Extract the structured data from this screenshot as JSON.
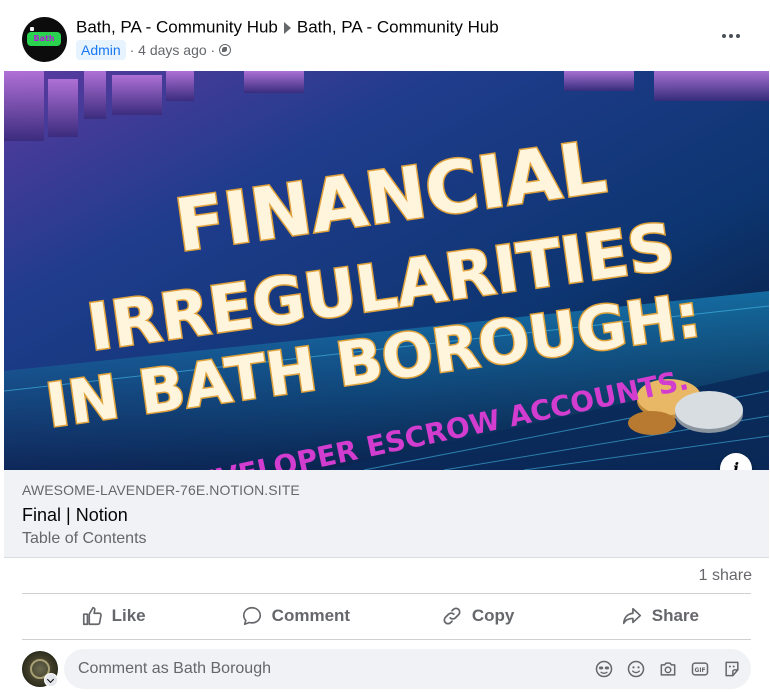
{
  "post": {
    "group_name": "Bath, PA - Community Hub",
    "group_name_repeat": "Bath, PA - Community Hub",
    "role_badge": "Admin",
    "timestamp": "4 days ago",
    "separator": "·",
    "avatar_badge_text": "Bath PA",
    "icons": {
      "more": "more-options-icon",
      "privacy": "globe-icon",
      "caret": "caret-right-icon"
    }
  },
  "hero": {
    "headline_line1": "FINANCIAL",
    "headline_line2": "IRREGULARITIES",
    "headline_line3": "IN BATH BOROUGH:",
    "subhead": "DEVELOPER ESCROW ACCOUNTS.",
    "info_label": "i"
  },
  "link_preview": {
    "domain": "AWESOME-LAVENDER-76E.NOTION.SITE",
    "title": "Final | Notion",
    "description": "Table of Contents"
  },
  "stats": {
    "shares": "1 share"
  },
  "actions": [
    {
      "label": "Like",
      "icon": "thumbs-up-icon"
    },
    {
      "label": "Comment",
      "icon": "comment-bubble-icon"
    },
    {
      "label": "Copy",
      "icon": "link-chain-icon"
    },
    {
      "label": "Share",
      "icon": "share-arrow-icon"
    }
  ],
  "composer": {
    "placeholder": "Comment as Bath Borough",
    "tools": [
      "avatar-sticker-icon",
      "emoji-icon",
      "camera-icon",
      "gif-icon",
      "sticker-icon"
    ]
  },
  "colors": {
    "accent": "#1877f2",
    "muted_text": "#65676b",
    "link_box_bg": "#f0f2f5",
    "headline_fill": "#fff4dc",
    "headline_outline": "#e0a23a",
    "subhead_color": "#d23ccf"
  }
}
